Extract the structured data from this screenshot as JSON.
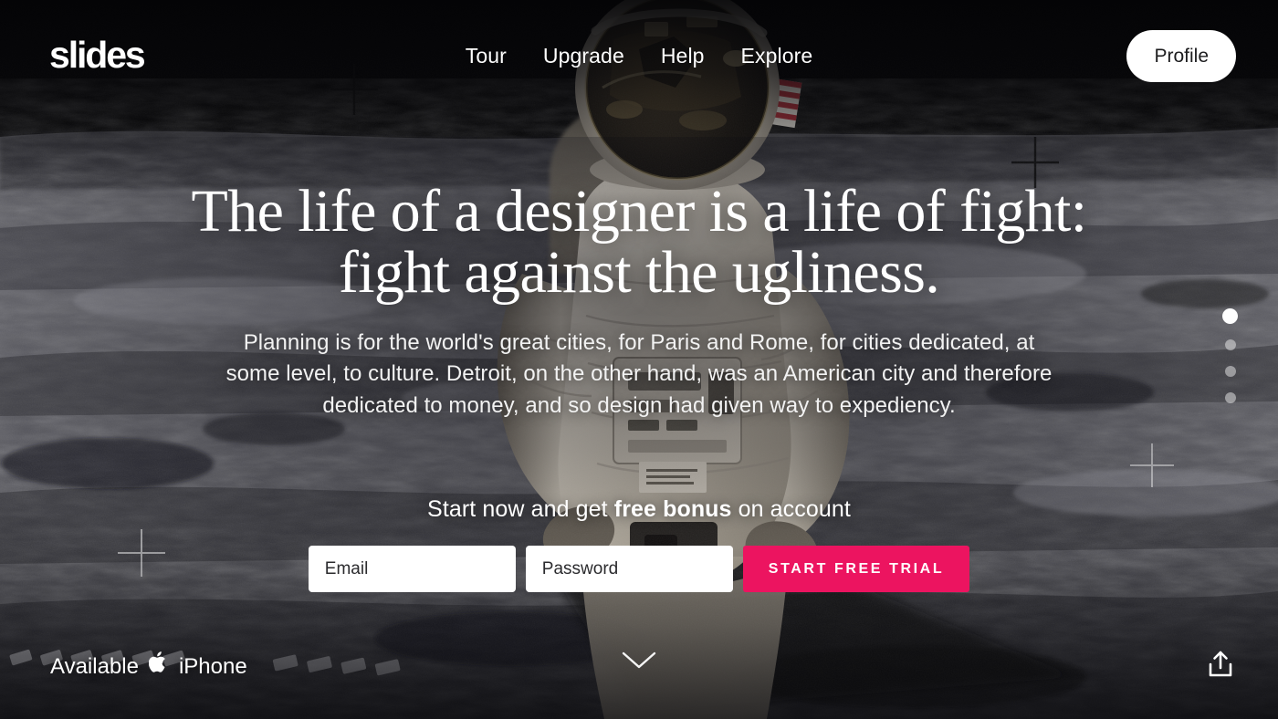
{
  "brand": {
    "logo": "slides"
  },
  "nav": {
    "items": [
      {
        "label": "Tour"
      },
      {
        "label": "Upgrade"
      },
      {
        "label": "Help"
      },
      {
        "label": "Explore"
      }
    ],
    "profile_label": "Profile"
  },
  "hero": {
    "headline_line1": "The life of a designer is a life of fight:",
    "headline_line2": "fight against the ugliness.",
    "subcopy": "Planning is for the world's great cities, for Paris and Rome, for cities dedicated, at some level, to culture. Detroit, on the other hand, was an American city and therefore dedicated to money, and so design had given way to expediency."
  },
  "cta": {
    "tagline_before": "Start now and get ",
    "tagline_bold": "free bonus",
    "tagline_after": " on account",
    "email_placeholder": "Email",
    "password_placeholder": "Password",
    "email_value": "",
    "password_value": "",
    "button_label": "START FREE TRIAL",
    "button_color": "#ec1460"
  },
  "slider": {
    "dots": [
      {
        "active": true
      },
      {
        "active": false
      },
      {
        "active": false
      },
      {
        "active": false
      }
    ]
  },
  "footer": {
    "available_prefix": "Available",
    "apple_glyph": "",
    "available_suffix": "iPhone",
    "scroll_icon": "chevron-down-icon",
    "share_icon": "share-icon"
  }
}
